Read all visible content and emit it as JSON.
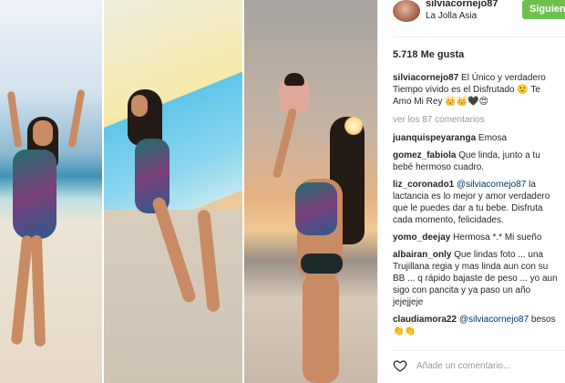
{
  "post": {
    "username": "silviacornejo87",
    "location": "La Jolla Asia",
    "follow_label": "Siguiendo",
    "likes": "5.718 Me gusta",
    "add_comment_placeholder": "Añade un comentario...",
    "view_more": "ver los 87 comentarios",
    "colors": {
      "follow": "#70c050",
      "mention": "#003569",
      "muted": "#999999"
    }
  },
  "caption": {
    "user": "silviacornejo87",
    "lines": [
      "El Único y verdadero",
      "Tiempo vivido es el Disfrutado 🙂 Te",
      "Amo Mi Rey 👑👑🖤😍"
    ]
  },
  "comments": [
    {
      "user": "juanquispeyaranga",
      "lines": [
        "Emosa"
      ]
    },
    {
      "user": "gomez_fabiola",
      "lines": [
        "Que linda, junto a tu",
        "bebé hermoso cuadro."
      ]
    },
    {
      "user": "liz_coronado1",
      "mention": "@silviacornejo87",
      "lines": [
        "la",
        "lactancia es lo mejor y amor verdadero",
        "que le puedes dar a tu bebe. Disfruta",
        "cada momento, felicidades."
      ]
    },
    {
      "user": "yomo_deejay",
      "lines": [
        "Hermosa *.* Mi sueño"
      ]
    },
    {
      "user": "albairan_only",
      "lines": [
        "Que lindas foto ... una",
        "Trujillana regia y mas linda aun con su",
        "BB ... q rápido bajaste de peso ... yo aun",
        "sigo con pancita y ya paso un año",
        "jejejjeje"
      ]
    },
    {
      "user": "claudiamora22",
      "mention": "@silviacornejo87",
      "lines": [
        "besos",
        "👏👏"
      ]
    }
  ],
  "icons": {
    "like": "heart-icon"
  }
}
